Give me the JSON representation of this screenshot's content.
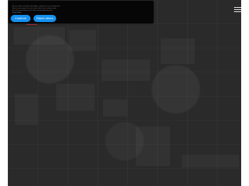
{
  "colors": {
    "background": "#2b2b2b",
    "consent_panel": "#060606",
    "button": "#1591ee",
    "accent": "#c62f2f"
  },
  "header": {
    "menu_icon": "menu-icon"
  },
  "consent": {
    "text": "We use cookies and similar technologies to improve site use and experience.\nSome are necessary for the site to work; others help us analyze usage.\nSee our Privacy Policy for more details and manage preferences.",
    "link_label": "Privacy Policy",
    "accept_label": "Continue",
    "reject_label": "Reject others"
  }
}
